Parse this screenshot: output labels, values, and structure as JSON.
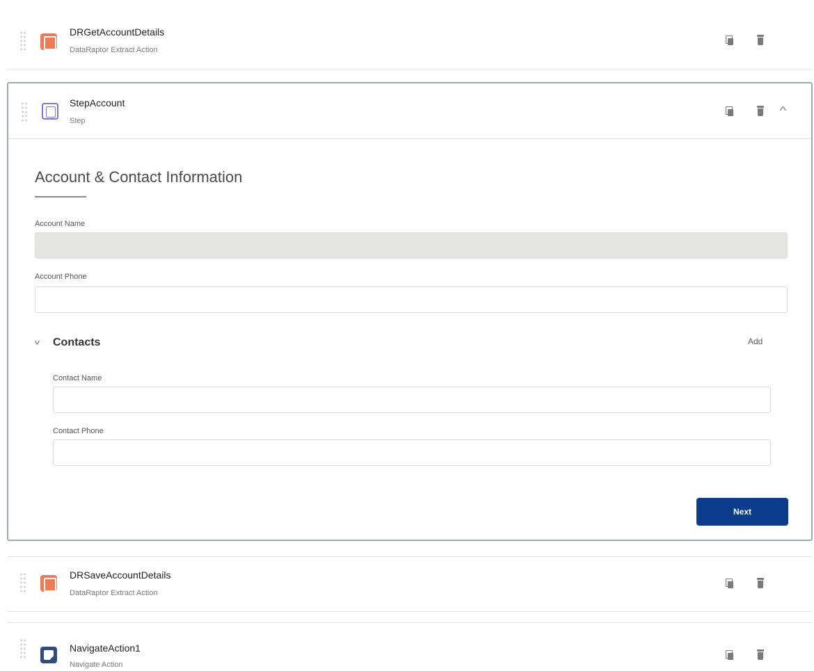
{
  "elements": {
    "top": {
      "name": "DRGetAccountDetails",
      "type": "DataRaptor Extract Action"
    },
    "step": {
      "name": "StepAccount",
      "type": "Step"
    },
    "save": {
      "name": "DRSaveAccountDetails",
      "type": "DataRaptor Extract Action"
    },
    "nav": {
      "name": "NavigateAction1",
      "type": "Navigate Action"
    }
  },
  "form": {
    "title": "Account & Contact Information",
    "account_name_label": "Account Name",
    "account_name_value": "",
    "account_phone_label": "Account Phone",
    "account_phone_value": "",
    "contacts": {
      "label": "Contacts",
      "add_label": "Add",
      "contact_name_label": "Contact Name",
      "contact_name_value": "",
      "contact_phone_label": "Contact Phone",
      "contact_phone_value": ""
    },
    "next_label": "Next"
  },
  "icons": {
    "dataraptor": "dataraptor-icon",
    "step": "step-icon",
    "navigate": "navigate-icon",
    "copy": "copy-icon",
    "delete": "trash-icon",
    "collapse": "chevron-up-icon",
    "expand": "chevron-down-icon",
    "drag": "drag-handle-icon"
  },
  "colors": {
    "dataraptor_icon": "#ee7b55",
    "step_icon": "#7b75d3",
    "navigate_icon": "#314b7a",
    "next_button": "#0b3d8c",
    "disabled_field": "#e4e4e2"
  }
}
